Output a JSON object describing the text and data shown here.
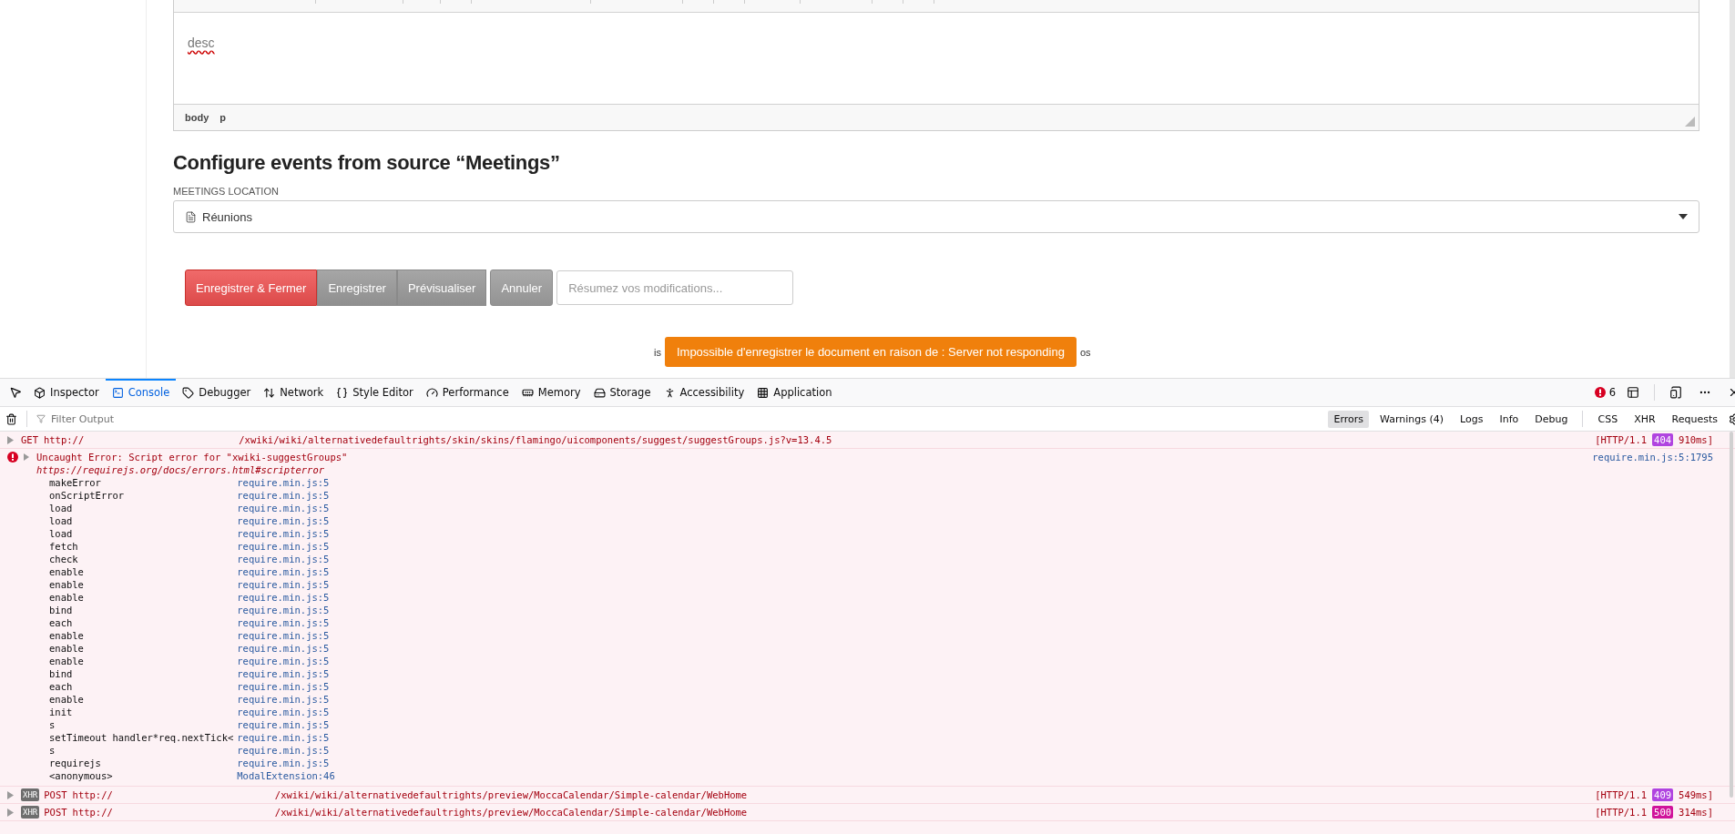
{
  "editor": {
    "content": "desc",
    "path": [
      "body",
      "p"
    ]
  },
  "section": {
    "heading": "Configure events from source “Meetings”",
    "field_label": "MEETINGS LOCATION",
    "select_value": "Réunions"
  },
  "actions": {
    "buttons": [
      {
        "label": "Enregistrer & Fermer",
        "kind": "primary"
      },
      {
        "label": "Enregistrer",
        "kind": "secondary"
      },
      {
        "label": "Prévisualiser",
        "kind": "secondary"
      },
      {
        "label": "Annuler",
        "kind": "cancel"
      }
    ],
    "summary_placeholder": "Résumez vos modifications..."
  },
  "notification": {
    "message": "Impossible d'enregistrer le document en raison de : Server not responding",
    "behind_start": "is",
    "behind_end": "os"
  },
  "devtools": {
    "tabs": [
      {
        "label": "Inspector",
        "selected": false
      },
      {
        "label": "Console",
        "selected": true
      },
      {
        "label": "Debugger",
        "selected": false
      },
      {
        "label": "Network",
        "selected": false
      },
      {
        "label": "Style Editor",
        "selected": false
      },
      {
        "label": "Performance",
        "selected": false
      },
      {
        "label": "Memory",
        "selected": false
      },
      {
        "label": "Storage",
        "selected": false
      },
      {
        "label": "Accessibility",
        "selected": false
      },
      {
        "label": "Application",
        "selected": false
      }
    ],
    "error_count": "6",
    "filter_placeholder": "Filter Output",
    "levels": [
      {
        "label": "Errors",
        "selected": true
      },
      {
        "label": "Warnings (4)",
        "selected": false
      },
      {
        "label": "Logs",
        "selected": false
      },
      {
        "label": "Info",
        "selected": false
      },
      {
        "label": "Debug",
        "selected": false
      }
    ],
    "types": [
      {
        "label": "CSS",
        "selected": false
      },
      {
        "label": "XHR",
        "selected": false
      },
      {
        "label": "Requests",
        "selected": false
      }
    ],
    "messages": [
      {
        "kind": "network",
        "method": "GET",
        "scheme": "http://",
        "path": "/xwiki/wiki/alternativedefaultrights/skin/skins/flamingo/uicomponents/suggest/suggestGroups.js?v=13.4.5",
        "protocol": "[HTTP/1.1",
        "status": "404",
        "color": "#b044e0",
        "timing": "910ms]"
      },
      {
        "kind": "error",
        "text": "Uncaught Error: Script error for \"xwiki-suggestGroups\"",
        "link": "https://requirejs.org/docs/errors.html#scripterror",
        "source": "require.min.js:5:1795",
        "stack": [
          {
            "fn": "makeError",
            "loc": "require.min.js:5"
          },
          {
            "fn": "onScriptError",
            "loc": "require.min.js:5"
          },
          {
            "fn": "load",
            "loc": "require.min.js:5"
          },
          {
            "fn": "load",
            "loc": "require.min.js:5"
          },
          {
            "fn": "load",
            "loc": "require.min.js:5"
          },
          {
            "fn": "fetch",
            "loc": "require.min.js:5"
          },
          {
            "fn": "check",
            "loc": "require.min.js:5"
          },
          {
            "fn": "enable",
            "loc": "require.min.js:5"
          },
          {
            "fn": "enable",
            "loc": "require.min.js:5"
          },
          {
            "fn": "enable",
            "loc": "require.min.js:5"
          },
          {
            "fn": "bind",
            "loc": "require.min.js:5"
          },
          {
            "fn": "each",
            "loc": "require.min.js:5"
          },
          {
            "fn": "enable",
            "loc": "require.min.js:5"
          },
          {
            "fn": "enable",
            "loc": "require.min.js:5"
          },
          {
            "fn": "enable",
            "loc": "require.min.js:5"
          },
          {
            "fn": "bind",
            "loc": "require.min.js:5"
          },
          {
            "fn": "each",
            "loc": "require.min.js:5"
          },
          {
            "fn": "enable",
            "loc": "require.min.js:5"
          },
          {
            "fn": "init",
            "loc": "require.min.js:5"
          },
          {
            "fn": "s",
            "loc": "require.min.js:5"
          },
          {
            "fn": "setTimeout handler*req.nextTick<",
            "loc": "require.min.js:5"
          },
          {
            "fn": "s",
            "loc": "require.min.js:5"
          },
          {
            "fn": "requirejs",
            "loc": "require.min.js:5"
          },
          {
            "fn": "<anonymous>",
            "loc": "ModalExtension:46"
          }
        ]
      },
      {
        "kind": "network",
        "badge": "XHR",
        "method": "POST",
        "scheme": "http://",
        "path": "/xwiki/wiki/alternativedefaultrights/preview/MoccaCalendar/Simple-calendar/WebHome",
        "protocol": "[HTTP/1.1",
        "status": "409",
        "color": "#b044e0",
        "timing": "549ms]"
      },
      {
        "kind": "network",
        "badge": "XHR",
        "method": "POST",
        "scheme": "http://",
        "path": "/xwiki/wiki/alternativedefaultrights/preview/MoccaCalendar/Simple-calendar/WebHome",
        "protocol": "[HTTP/1.1",
        "status": "500",
        "color": "#d0149b",
        "timing": "314ms]"
      }
    ]
  }
}
